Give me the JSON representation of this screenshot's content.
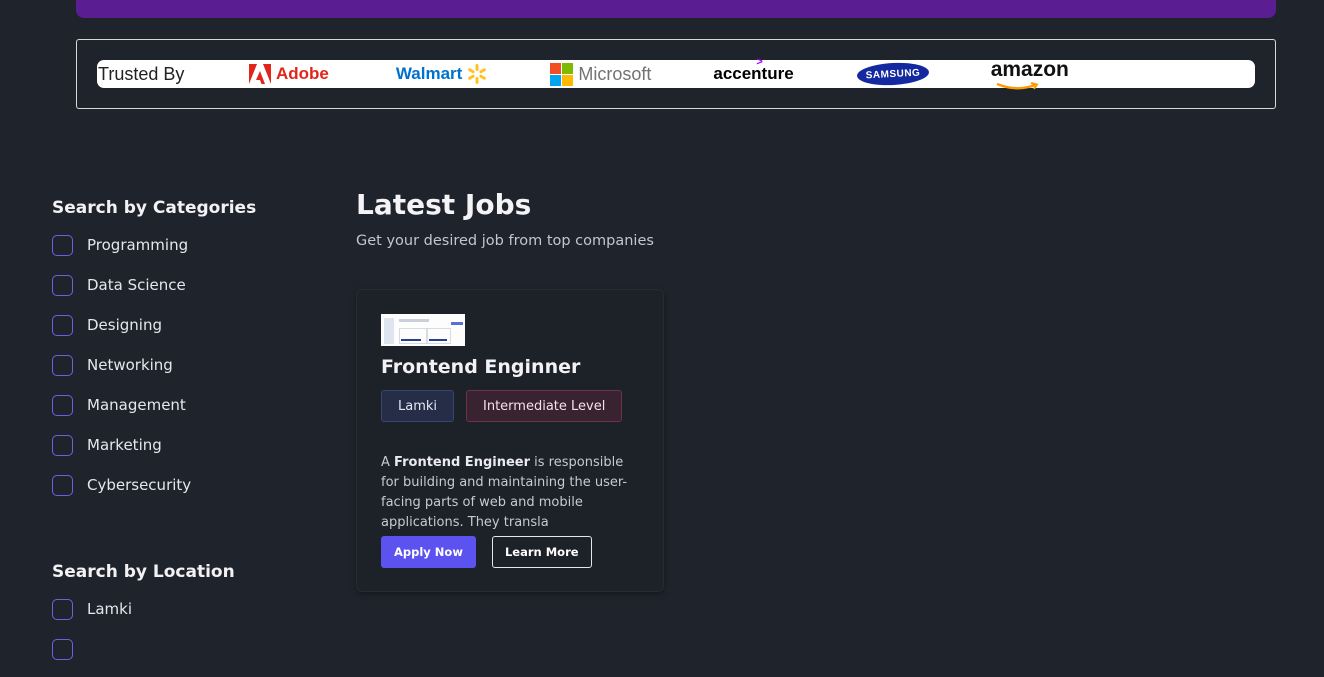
{
  "trusted": {
    "label": "Trusted By",
    "companies": [
      "Adobe",
      "Walmart",
      "Microsoft",
      "accenture",
      "SAMSUNG",
      "amazon"
    ]
  },
  "categories": {
    "title": "Search by Categories",
    "items": [
      "Programming",
      "Data Science",
      "Designing",
      "Networking",
      "Management",
      "Marketing",
      "Cybersecurity"
    ]
  },
  "locations": {
    "title": "Search by Location",
    "items": [
      "Lamki",
      ""
    ]
  },
  "jobs": {
    "title": "Latest Jobs",
    "subtitle": "Get your desired job from top companies",
    "cards": [
      {
        "title": "Frontend Enginner",
        "location": "Lamki",
        "level": "Intermediate Level",
        "desc_prefix": "A",
        "desc_bold": "Frontend Engineer",
        "desc_rest": "is responsible for building and maintaining the user-facing parts of web and mobile applications. They transla",
        "apply_label": "Apply Now",
        "learn_label": "Learn More"
      }
    ]
  },
  "colors": {
    "background": "#1f232b",
    "accent": "#5b52f0",
    "hero": "#5b1d92",
    "checkbox_border": "#6a63e0"
  }
}
